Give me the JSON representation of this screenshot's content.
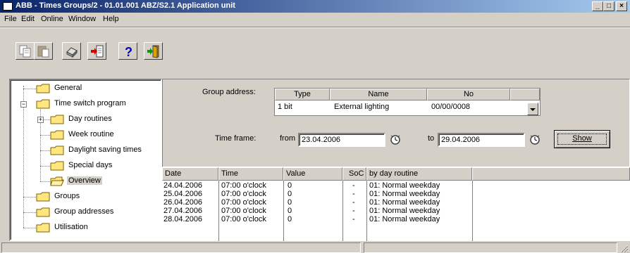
{
  "window": {
    "title": "ABB - Times Groups/2 - 01.01.001 ABZ/S2.1 Application unit",
    "minimize": "_",
    "maximize": "□",
    "close": "×"
  },
  "menu": [
    {
      "label": "File"
    },
    {
      "label": "Edit"
    },
    {
      "label": "Online"
    },
    {
      "label": "Window"
    },
    {
      "label": "Help"
    }
  ],
  "toolbar": {
    "icons": [
      "copy-icon",
      "paste-icon",
      "print-icon",
      "import-icon",
      "help-icon",
      "exit-icon"
    ]
  },
  "tree": {
    "general": "General",
    "time_switch_program": "Time switch program",
    "day_routines": "Day routines",
    "week_routine": "Week routine",
    "daylight_saving_times": "Daylight saving times",
    "special_days": "Special days",
    "overview": "Overview",
    "groups": "Groups",
    "group_addresses": "Group addresses",
    "utilisation": "Utilisation"
  },
  "group_address": {
    "label": "Group address:",
    "col_type": "Type",
    "col_name": "Name",
    "col_no": "No",
    "type_value": "1 bit",
    "name_value": "External lighting",
    "no_value": "00/00/0008"
  },
  "time_frame": {
    "label": "Time frame:",
    "from_label": "from",
    "from_value": "23.04.2006",
    "to_label": "to",
    "to_value": "29.04.2006",
    "show_button": "Show"
  },
  "table": {
    "headers": [
      "Date",
      "Time",
      "Value",
      "SoC",
      "by day routine"
    ],
    "rows": [
      [
        "24.04.2006",
        "07:00 o'clock",
        "0",
        "-",
        "01: Normal weekday"
      ],
      [
        "25.04.2006",
        "07:00 o'clock",
        "0",
        "-",
        "01: Normal weekday"
      ],
      [
        "26.04.2006",
        "07:00 o'clock",
        "0",
        "-",
        "01: Normal weekday"
      ],
      [
        "27.04.2006",
        "07:00 o'clock",
        "0",
        "-",
        "01: Normal weekday"
      ],
      [
        "28.04.2006",
        "07:00 o'clock",
        "0",
        "-",
        "01: Normal weekday"
      ]
    ]
  },
  "colors": {
    "titlebar_start": "#0a246a",
    "titlebar_end": "#a6caf0",
    "face": "#d4d0c8",
    "folder": "#ffe680"
  }
}
